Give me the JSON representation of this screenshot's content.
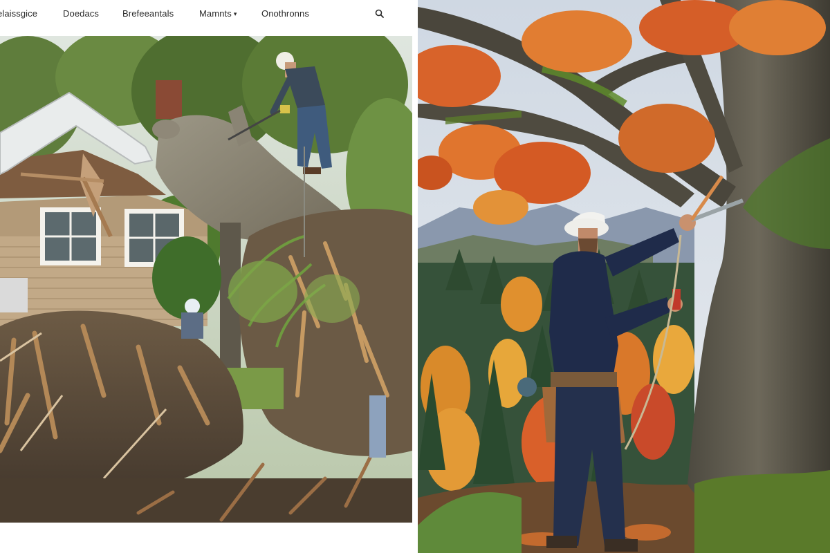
{
  "nav": {
    "items": [
      {
        "label": "elaissgice"
      },
      {
        "label": "Doedacs"
      },
      {
        "label": "Brefeeantals"
      },
      {
        "label": "Mamnts",
        "dropdown": true
      },
      {
        "label": "Onothronns"
      }
    ],
    "search_icon": "magnifier"
  },
  "colors": {
    "nav_text": "#2a2a2a",
    "background": "#ffffff",
    "foliage_autumn": "#d8632a",
    "bark": "#5b5446",
    "moss": "#5a7a2a",
    "shirt_navy": "#1f2b4a"
  },
  "images": {
    "left_photo": "storm-felled tree crushing a house with workers and crane",
    "right_photo": "arborist pruning a mossy tree on autumn hillside"
  }
}
